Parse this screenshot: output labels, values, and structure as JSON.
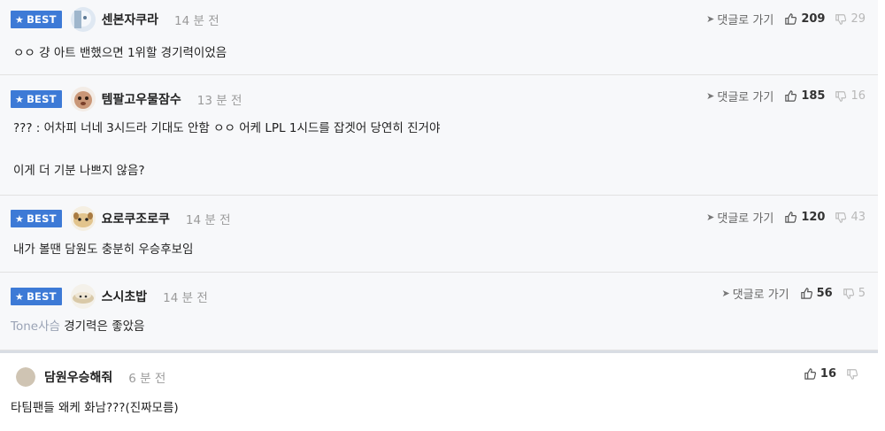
{
  "comments": [
    {
      "badge": "BEST",
      "nickname": "센본자쿠라",
      "time": "14 분 전",
      "reply_label": "댓글로 가기",
      "up": "209",
      "down": "29",
      "body": "ㅇㅇ 걍 아트 밴했으면 1위할 경기력이었음"
    },
    {
      "badge": "BEST",
      "nickname": "템팔고우물잠수",
      "time": "13 분 전",
      "reply_label": "댓글로 가기",
      "up": "185",
      "down": "16",
      "body_line1": "??? : 어차피 너네 3시드라 기대도 안함 ㅇㅇ 어케 LPL 1시드를 잡겟어 당연히 진거야",
      "body_line2": "이게 더 기분 나쁘지 않음?"
    },
    {
      "badge": "BEST",
      "nickname": "요로쿠조로쿠",
      "time": "14 분 전",
      "reply_label": "댓글로 가기",
      "up": "120",
      "down": "43",
      "body": "내가 볼땐 담원도 충분히 우승후보임"
    },
    {
      "badge": "BEST",
      "nickname": "스시초밥",
      "time": "14 분 전",
      "reply_label": "댓글로 가기",
      "up": "56",
      "down": "5",
      "body_tag": "Tone사슴",
      "body": "경기력은 좋았음"
    },
    {
      "nickname": "담원우승해줘",
      "time": "6 분 전",
      "up": "16",
      "down": "",
      "body": "타팀팬들 왜케 화남???(진짜모름)"
    }
  ],
  "colors": {
    "best_badge": "#3d7ad6",
    "best_background": "#f7f8fa",
    "time_text": "#9a9a9a",
    "tag_text": "#9aa3b5"
  },
  "icons": {
    "badge_star": "star-icon",
    "reply": "reply-arrow-icon",
    "up": "thumbs-up-icon",
    "down": "thumbs-down-icon"
  }
}
